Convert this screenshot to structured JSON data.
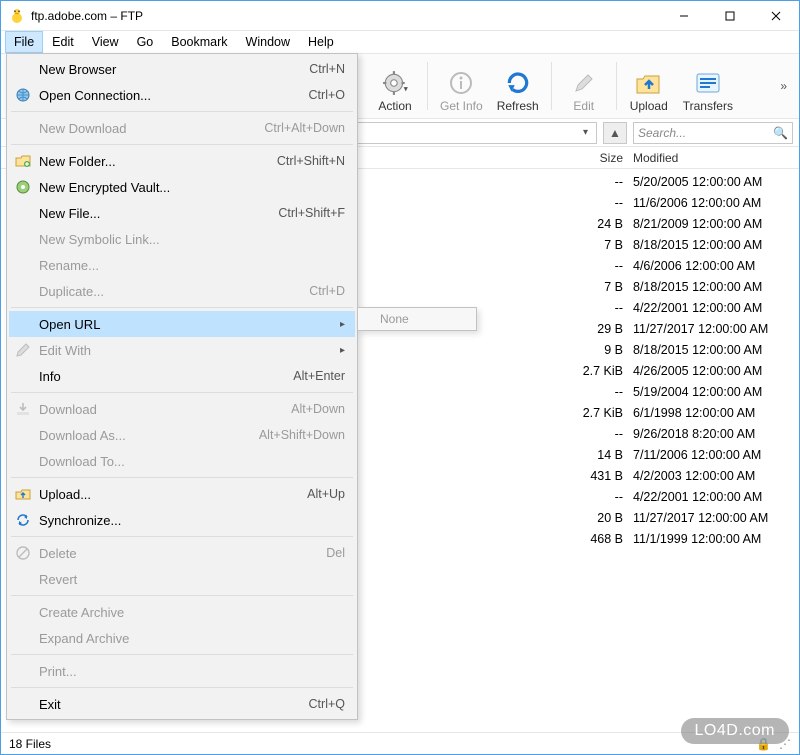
{
  "window": {
    "title": "ftp.adobe.com – FTP"
  },
  "menubar": [
    "File",
    "Edit",
    "View",
    "Go",
    "Bookmark",
    "Window",
    "Help"
  ],
  "toolbar": {
    "action": "Action",
    "getinfo": "Get Info",
    "refresh": "Refresh",
    "edit": "Edit",
    "upload": "Upload",
    "transfers": "Transfers"
  },
  "search": {
    "placeholder": "Search..."
  },
  "columns": {
    "size": "Size",
    "modified": "Modified"
  },
  "rows": [
    {
      "size": "--",
      "mod": "5/20/2005 12:00:00 AM"
    },
    {
      "size": "--",
      "mod": "11/6/2006 12:00:00 AM"
    },
    {
      "size": "24 B",
      "mod": "8/21/2009 12:00:00 AM"
    },
    {
      "size": "7 B",
      "mod": "8/18/2015 12:00:00 AM"
    },
    {
      "size": "--",
      "mod": "4/6/2006 12:00:00 AM"
    },
    {
      "size": "7 B",
      "mod": "8/18/2015 12:00:00 AM"
    },
    {
      "size": "--",
      "mod": "4/22/2001 12:00:00 AM"
    },
    {
      "size": "29 B",
      "mod": "11/27/2017 12:00:00 AM"
    },
    {
      "size": "9 B",
      "mod": "8/18/2015 12:00:00 AM"
    },
    {
      "size": "2.7 KiB",
      "mod": "4/26/2005 12:00:00 AM"
    },
    {
      "size": "--",
      "mod": "5/19/2004 12:00:00 AM"
    },
    {
      "size": "2.7 KiB",
      "mod": "6/1/1998 12:00:00 AM"
    },
    {
      "size": "--",
      "mod": "9/26/2018 8:20:00 AM"
    },
    {
      "size": "14 B",
      "mod": "7/11/2006 12:00:00 AM"
    },
    {
      "size": "431 B",
      "mod": "4/2/2003 12:00:00 AM"
    },
    {
      "size": "--",
      "mod": "4/22/2001 12:00:00 AM"
    },
    {
      "size": "20 B",
      "mod": "11/27/2017 12:00:00 AM"
    },
    {
      "size": "468 B",
      "mod": "11/1/1999 12:00:00 AM"
    }
  ],
  "status": {
    "left": "18 Files"
  },
  "watermark": "LO4D.com",
  "fileMenu": [
    {
      "type": "item",
      "label": "New Browser",
      "shortcut": "Ctrl+N",
      "icon": ""
    },
    {
      "type": "item",
      "label": "Open Connection...",
      "shortcut": "Ctrl+O",
      "icon": "globe"
    },
    {
      "type": "sep"
    },
    {
      "type": "item",
      "label": "New Download",
      "shortcut": "Ctrl+Alt+Down",
      "disabled": true
    },
    {
      "type": "sep"
    },
    {
      "type": "item",
      "label": "New Folder...",
      "shortcut": "Ctrl+Shift+N",
      "icon": "folderplus"
    },
    {
      "type": "item",
      "label": "New Encrypted Vault...",
      "shortcut": "",
      "icon": "vault"
    },
    {
      "type": "item",
      "label": "New File...",
      "shortcut": "Ctrl+Shift+F"
    },
    {
      "type": "item",
      "label": "New Symbolic Link...",
      "shortcut": "",
      "disabled": true
    },
    {
      "type": "item",
      "label": "Rename...",
      "shortcut": "",
      "disabled": true
    },
    {
      "type": "item",
      "label": "Duplicate...",
      "shortcut": "Ctrl+D",
      "disabled": true
    },
    {
      "type": "sep"
    },
    {
      "type": "item",
      "label": "Open URL",
      "shortcut": "",
      "selected": true,
      "submenu": true
    },
    {
      "type": "item",
      "label": "Edit With",
      "shortcut": "",
      "disabled": true,
      "submenu": true,
      "icon": "pencil"
    },
    {
      "type": "item",
      "label": "Info",
      "shortcut": "Alt+Enter"
    },
    {
      "type": "sep"
    },
    {
      "type": "item",
      "label": "Download",
      "shortcut": "Alt+Down",
      "disabled": true,
      "icon": "download"
    },
    {
      "type": "item",
      "label": "Download As...",
      "shortcut": "Alt+Shift+Down",
      "disabled": true
    },
    {
      "type": "item",
      "label": "Download To...",
      "shortcut": "",
      "disabled": true
    },
    {
      "type": "sep"
    },
    {
      "type": "item",
      "label": "Upload...",
      "shortcut": "Alt+Up",
      "icon": "upload"
    },
    {
      "type": "item",
      "label": "Synchronize...",
      "shortcut": "",
      "icon": "sync"
    },
    {
      "type": "sep"
    },
    {
      "type": "item",
      "label": "Delete",
      "shortcut": "Del",
      "disabled": true,
      "icon": "delete"
    },
    {
      "type": "item",
      "label": "Revert",
      "shortcut": "",
      "disabled": true
    },
    {
      "type": "sep"
    },
    {
      "type": "item",
      "label": "Create Archive",
      "shortcut": "",
      "disabled": true
    },
    {
      "type": "item",
      "label": "Expand Archive",
      "shortcut": "",
      "disabled": true
    },
    {
      "type": "sep"
    },
    {
      "type": "item",
      "label": "Print...",
      "shortcut": "",
      "disabled": true
    },
    {
      "type": "sep"
    },
    {
      "type": "item",
      "label": "Exit",
      "shortcut": "Ctrl+Q"
    }
  ],
  "submenu": {
    "none": "None"
  }
}
